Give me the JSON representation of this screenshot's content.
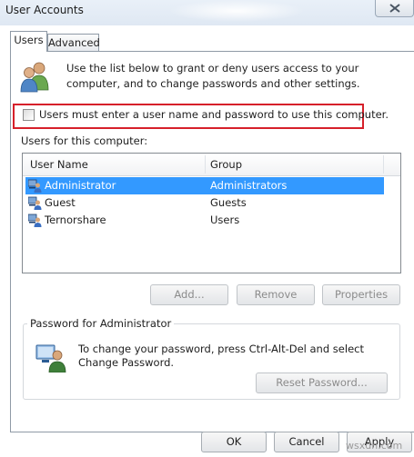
{
  "window": {
    "title": "User Accounts"
  },
  "tabs": [
    {
      "label": "Users",
      "active": true
    },
    {
      "label": "Advanced",
      "active": false
    }
  ],
  "description": "Use the list below to grant or deny users access to your computer, and to change passwords and other settings.",
  "require_login": {
    "label": "Users must enter a user name and password to use this computer.",
    "checked": false,
    "highlight_color": "#d6202a"
  },
  "users_section": {
    "label": "Users for this computer:",
    "columns": [
      "User Name",
      "Group"
    ],
    "rows": [
      {
        "name": "Administrator",
        "group": "Administrators",
        "selected": true
      },
      {
        "name": "Guest",
        "group": "Guests",
        "selected": false
      },
      {
        "name": "Ternorshare",
        "group": "Users",
        "selected": false
      }
    ],
    "selection_color": "#3399ff"
  },
  "list_buttons": {
    "add": "Add...",
    "remove": "Remove",
    "properties": "Properties"
  },
  "password_group": {
    "label": "Password for Administrator",
    "text": "To change your password, press Ctrl-Alt-Del and select Change Password.",
    "reset_button": "Reset Password..."
  },
  "dialog_buttons": {
    "ok": "OK",
    "cancel": "Cancel",
    "apply": "Apply"
  },
  "watermark": "wsxdn.com"
}
